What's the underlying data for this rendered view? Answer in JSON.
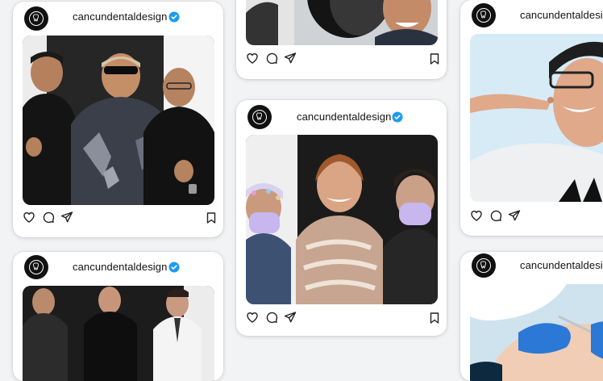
{
  "account": {
    "username": "cancundentaldesign"
  },
  "colors": {
    "verified_badge": "#1d9bf0",
    "glove_blue": "#2b78d6"
  },
  "icons": [
    "like-icon",
    "comment-icon",
    "share-icon",
    "save-icon",
    "verified-icon",
    "tooth-logo-icon"
  ],
  "posts": [
    {
      "id": "post-1",
      "photo": "Three smiling men posing, one giving a thumbs up"
    },
    {
      "id": "post-2",
      "photo": "Two smiling people in clinic (cropped)"
    },
    {
      "id": "post-3",
      "photo": "Woman pointing at her smile"
    },
    {
      "id": "post-4",
      "photo": "Patient with two dental assistants in masks"
    },
    {
      "id": "post-5",
      "photo": "Three men and a woman in white coat seated"
    },
    {
      "id": "post-6",
      "photo": "Dentist with blue gloves treating patient"
    }
  ]
}
